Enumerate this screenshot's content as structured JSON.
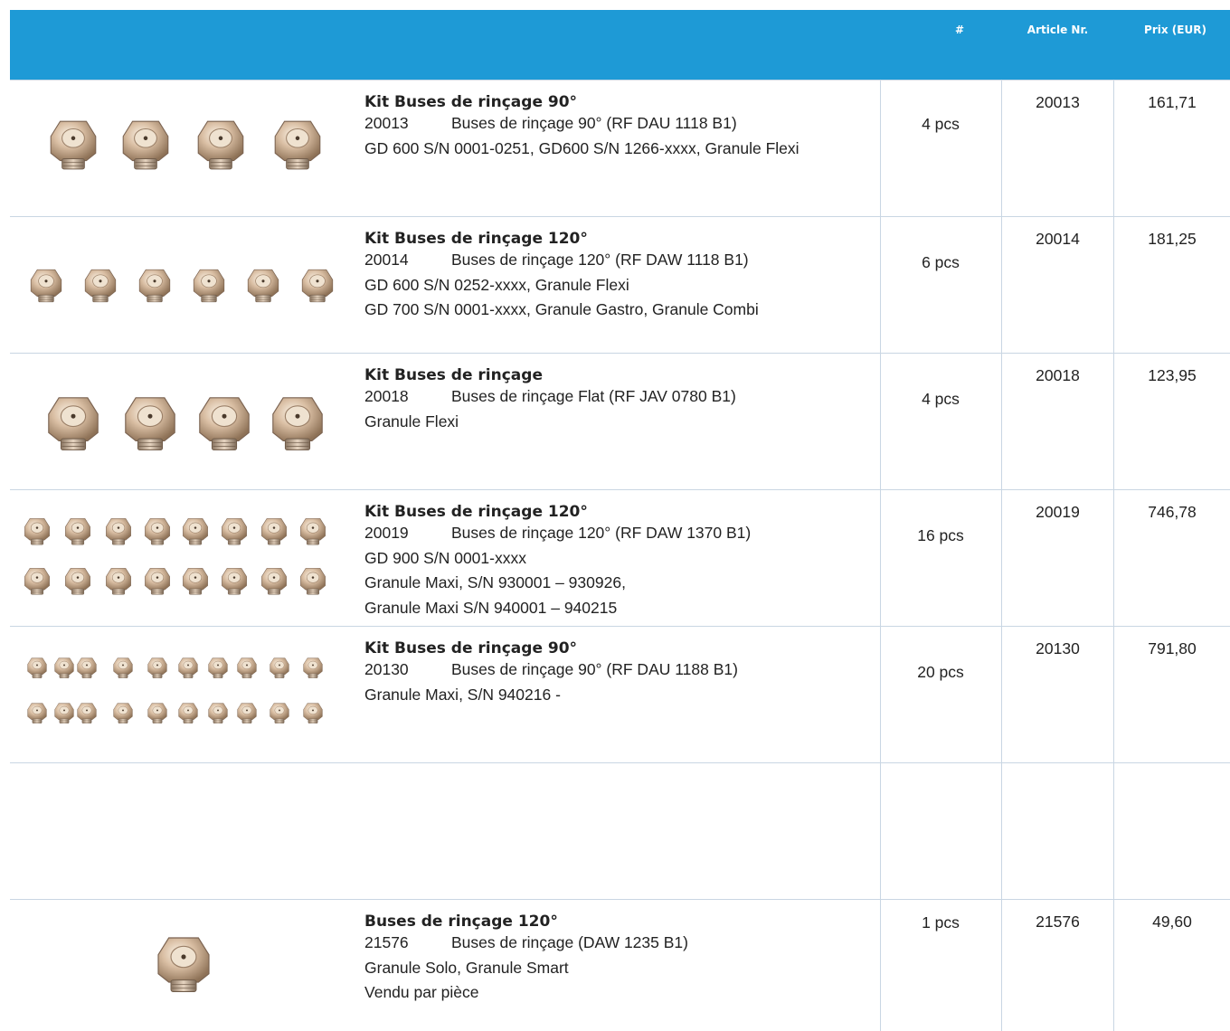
{
  "header": {
    "qty_label": "#",
    "article_label": "Article Nr.",
    "price_label": "Prix (EUR)"
  },
  "rows": [
    {
      "title": "Kit Buses de rinçage 90°",
      "code": "20013",
      "code_desc": "Buses de rinçage 90° (RF DAU 1118 B1)",
      "lines": [
        "GD 600 S/N 0001-0251, GD600 S/N 1266-xxxx, Granule Flexi"
      ],
      "qty": "4 pcs",
      "article": "20013",
      "price": "161,71"
    },
    {
      "title": "Kit Buses de rinçage 120°",
      "code": "20014",
      "code_desc": "Buses de rinçage 120° (RF DAW 1118 B1)",
      "lines": [
        "GD 600 S/N 0252-xxxx, Granule Flexi",
        "GD 700 S/N 0001-xxxx, Granule Gastro, Granule Combi"
      ],
      "qty": "6 pcs",
      "article": "20014",
      "price": "181,25"
    },
    {
      "title": "Kit Buses de rinçage",
      "code": "20018",
      "code_desc": "Buses de rinçage Flat (RF JAV 0780 B1)",
      "lines": [
        "Granule Flexi"
      ],
      "qty": "4 pcs",
      "article": "20018",
      "price": "123,95"
    },
    {
      "title": "Kit Buses de rinçage 120°",
      "code": "20019",
      "code_desc": "Buses de rinçage 120° (RF DAW 1370 B1)",
      "lines": [
        "GD 900 S/N 0001-xxxx",
        "Granule Maxi, S/N 930001 – 930926,",
        "Granule Maxi S/N 940001 – 940215"
      ],
      "qty": "16 pcs",
      "article": "20019",
      "price": "746,78"
    },
    {
      "title": "Kit Buses de rinçage 90°",
      "code": "20130",
      "code_desc": "Buses de rinçage 90° (RF DAU 1188 B1)",
      "lines": [
        "Granule Maxi, S/N 940216 -"
      ],
      "qty": "20 pcs",
      "article": "20130",
      "price": "791,80"
    },
    {
      "title": "",
      "code": "",
      "code_desc": "",
      "lines": [],
      "qty": "",
      "article": "",
      "price": ""
    },
    {
      "title": "Buses de rinçage 120°",
      "code": "21576",
      "code_desc": "Buses de rinçage (DAW 1235 B1)",
      "lines": [
        "Granule Solo, Granule Smart",
        "Vendu par pièce"
      ],
      "qty": "1 pcs",
      "article": "21576",
      "price": "49,60"
    }
  ],
  "colors": {
    "header_bg": "#1e9ad6",
    "grid_line": "#c9d6e3",
    "nozzle_metal": "#c9a98f"
  },
  "icons": {
    "product_image": "rinse-nozzle-icon"
  }
}
